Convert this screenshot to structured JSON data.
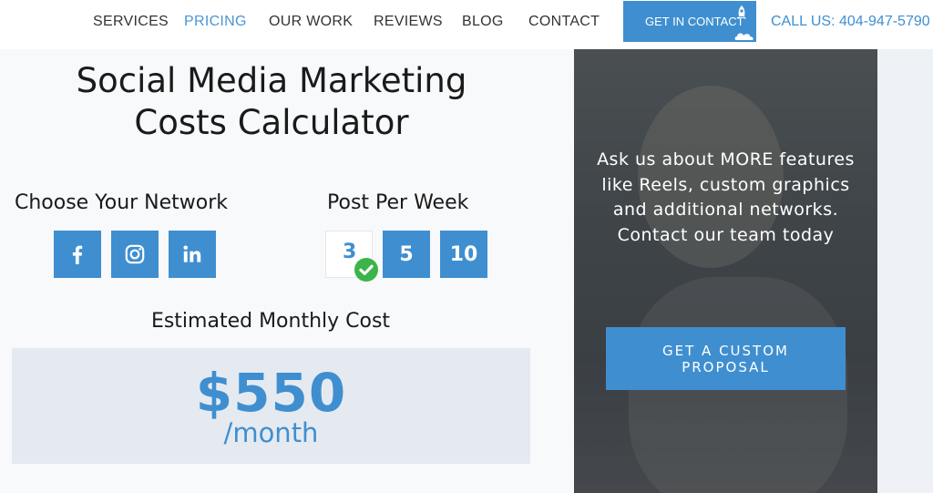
{
  "nav": {
    "items": [
      {
        "label": "SERVICES",
        "active": false
      },
      {
        "label": "PRICING",
        "active": true
      },
      {
        "label": "OUR WORK",
        "active": false
      },
      {
        "label": "REVIEWS",
        "active": false
      },
      {
        "label": "BLOG",
        "active": false
      },
      {
        "label": "CONTACT",
        "active": false
      }
    ],
    "cta_label": "GET IN CONTACT",
    "call_label": "CALL US: 404-947-5790"
  },
  "calculator": {
    "title_line1": "Social Media Marketing",
    "title_line2": "Costs Calculator",
    "network_heading": "Choose Your Network",
    "networks": [
      {
        "icon": "facebook-icon"
      },
      {
        "icon": "instagram-icon"
      },
      {
        "icon": "linkedin-icon"
      }
    ],
    "posts_heading": "Post Per Week",
    "posts_options": [
      "3",
      "5",
      "10"
    ],
    "posts_selected": "3",
    "estimate_label": "Estimated Monthly Cost",
    "price": "$550",
    "period": "/month"
  },
  "promo": {
    "text": "Ask us about MORE features like Reels, custom graphics and additional networks. Contact our team today",
    "button_label": "GET A CUSTOM PROPOSAL"
  },
  "colors": {
    "accent": "#3f8fd0",
    "text": "#1a1a1a",
    "price_box_bg": "#e5eaf1",
    "check_green": "#3bb54a"
  }
}
